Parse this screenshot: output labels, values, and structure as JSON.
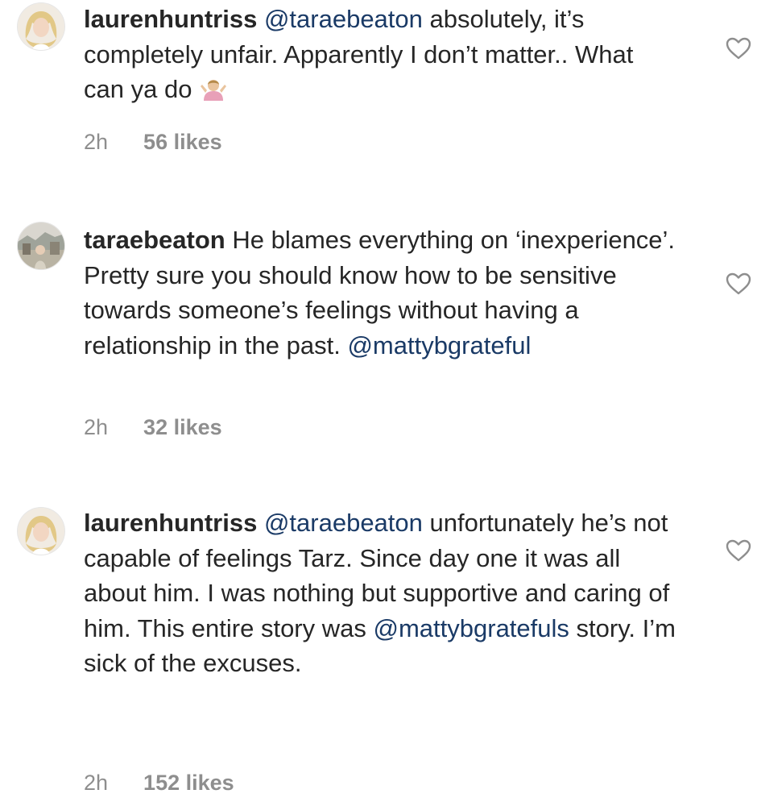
{
  "comments": [
    {
      "username": "laurenhuntriss",
      "mention": "@taraebeaton",
      "text": "absolutely, it’s completely unfair. Apparently I don’t matter.. What can ya do",
      "time": "2h",
      "likes": "56 likes",
      "icons": [
        "avatar-blonde",
        "shrug-emoji",
        "heart-outline"
      ]
    },
    {
      "username": "taraebeaton",
      "text": "He blames everything on ‘inexperience’. Pretty sure you should know how to be sensitive towards someone’s feelings without having a relationship in the past.",
      "mention": "@mattybgrateful",
      "time": "2h",
      "likes": "32 likes",
      "icons": [
        "avatar-outdoor",
        "heart-outline"
      ]
    },
    {
      "username": "laurenhuntriss",
      "mention": "@taraebeaton",
      "text_before": "unfortunately he’s not capable of feelings Tarz. Since day one it was all about him. I was nothing but supportive and caring of him. This entire story was",
      "mention2": "@mattybgratefuls",
      "text_after": "story. I’m sick of the excuses.",
      "time": "2h",
      "likes": "152 likes",
      "icons": [
        "avatar-blonde",
        "heart-outline"
      ]
    }
  ],
  "colors": {
    "text": "#262626",
    "meta": "#8e8e8e",
    "mention": "#1a3a66",
    "heart": "#8e8e8e"
  }
}
